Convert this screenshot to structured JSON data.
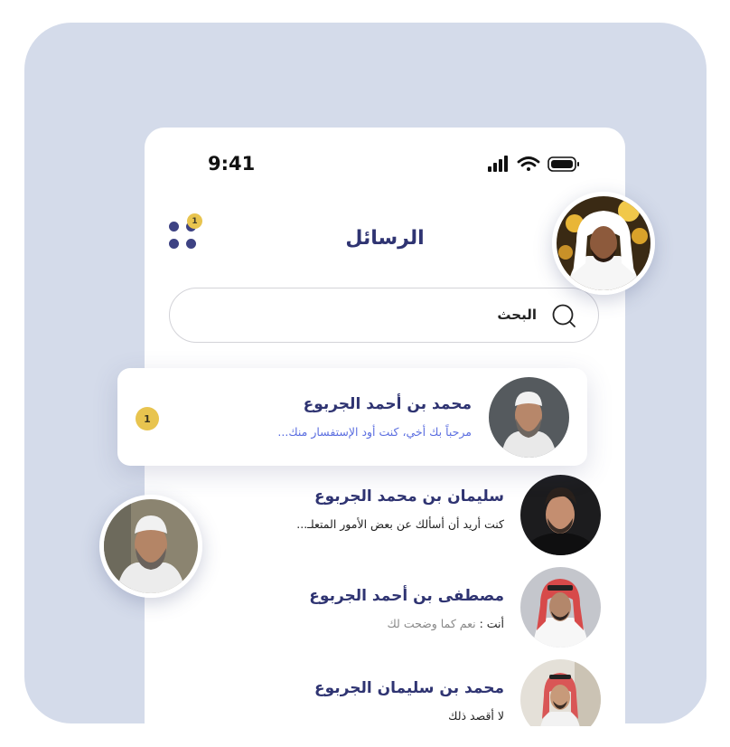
{
  "status_bar": {
    "time": "9:41"
  },
  "header": {
    "title": "الرسائل",
    "menu_badge": "1"
  },
  "search": {
    "label": "البحث"
  },
  "conversations": [
    {
      "name": "محمد بن أحمد الجربوع",
      "message": "مرحباً بك أخي، كنت أود الإستفسار منك...",
      "unread": "1",
      "highlighted": true
    },
    {
      "name": "سليمان بن محمد الجربوع",
      "message": "كنت أريد أن أسألك عن بعض الأمور المتعلـ..."
    },
    {
      "name": "مصطفى بن أحمد الجربوع",
      "message_prefix": "أنت :",
      "message": "نعم كما وضحت لك"
    },
    {
      "name": "محمد بن سليمان الجربوع",
      "message": "لا أقصد ذلك"
    }
  ],
  "colors": {
    "backdrop": "#d4dbea",
    "primary": "#2f3472",
    "accent": "#e8c44f",
    "link": "#5b6ee0"
  }
}
